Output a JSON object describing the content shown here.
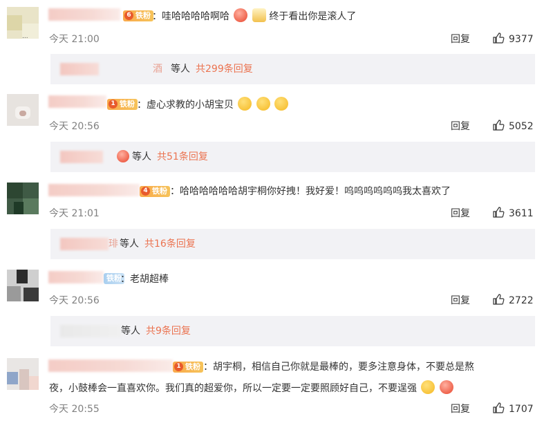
{
  "comments": [
    {
      "badge_level": "6",
      "badge_label": "铁粉",
      "text": "：哇哈哈哈哈啊哈",
      "text_tail": " 终于看出你是滚人了",
      "avatar_corner": "...",
      "time": "今天 21:00",
      "reply_label": "回复",
      "likes": "9377",
      "thread": {
        "name_suffix": "酒",
        "who": "等人",
        "count": "共299条回复"
      }
    },
    {
      "badge_level": "1",
      "badge_label": "铁粉",
      "text": "：虚心求教的小胡宝贝",
      "time": "今天 20:56",
      "reply_label": "回复",
      "likes": "5052",
      "thread": {
        "name_suffix": "",
        "who": "等人",
        "count": "共51条回复"
      }
    },
    {
      "badge_level": "4",
      "badge_label": "铁粉",
      "text": "：哈哈哈哈哈哈胡宇桐你好拽！我好爱！呜呜呜呜呜呜我太喜欢了",
      "time": "今天 21:01",
      "reply_label": "回复",
      "likes": "3611",
      "thread": {
        "name_suffix": "琲",
        "who": "等人",
        "count": "共16条回复"
      }
    },
    {
      "badge_level": "",
      "badge_label": "铁粉",
      "text": "：老胡超棒",
      "time": "今天 20:56",
      "reply_label": "回复",
      "likes": "2722",
      "thread": {
        "name_suffix": "",
        "who": "等人",
        "count": "共9条回复"
      }
    },
    {
      "badge_level": "1",
      "badge_label": "铁粉",
      "text": "：胡宇桐，相信自己你就是最棒的，要多注意身体，不要总是熬",
      "text_line2": "夜，小鼓棒会一直喜欢你。我们真的超爱你，所以一定要一定要照顾好自己，不要逞强",
      "time": "今天 20:55",
      "reply_label": "回复",
      "likes": "1707"
    }
  ],
  "colors": {
    "accent": "#eb7350",
    "time": "#808080",
    "reply_bg": "#f2f2f5",
    "badge": "#f9a94b"
  },
  "icons": {
    "like": "thumbs-up-icon",
    "emoji": "smile-emoji-icon"
  }
}
